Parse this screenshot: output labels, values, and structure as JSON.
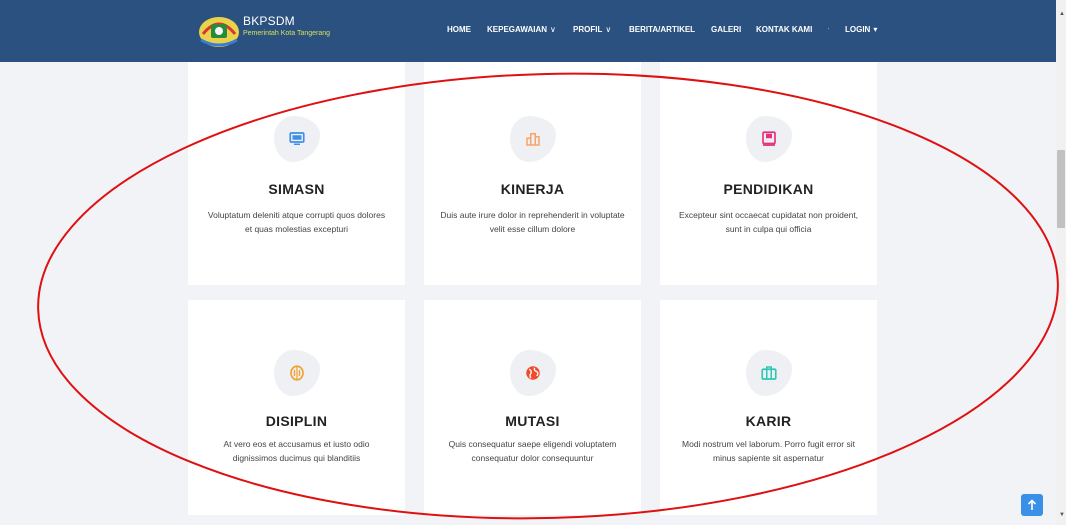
{
  "brand": {
    "name": "BKPSDM",
    "subtitle": "Pemerintah Kota Tangerang"
  },
  "nav": [
    {
      "label": "HOME",
      "caret": ""
    },
    {
      "label": "KEPEGAWAIAN",
      "caret": "∨"
    },
    {
      "label": "PROFIL",
      "caret": "∨"
    },
    {
      "label": "BERITA/ARTIKEL",
      "caret": ""
    },
    {
      "label": "GALERI",
      "caret": ""
    },
    {
      "label": "KONTAK KAMI",
      "caret": ""
    },
    {
      "label": "LOGIN",
      "caret": "▾"
    }
  ],
  "cards": [
    {
      "title": "SIMASN",
      "icon": "monitor-icon",
      "color": "#3d8fe8",
      "desc1": "Voluptatum deleniti atque corrupti quos dolores",
      "desc2": "et quas molestias excepturi"
    },
    {
      "title": "KINERJA",
      "icon": "bar-chart-icon",
      "color": "#f7a46b",
      "desc1": "Duis aute irure dolor in reprehenderit in voluptate",
      "desc2": "velit esse cillum dolore"
    },
    {
      "title": "PENDIDIKAN",
      "icon": "book-icon",
      "color": "#e5307c",
      "desc1": "Excepteur sint occaecat cupidatat non proident,",
      "desc2": "sunt in culpa qui officia"
    },
    {
      "title": "DISIPLIN",
      "icon": "brain-icon",
      "color": "#f0a030",
      "desc1": "At vero eos et accusamus et iusto odio",
      "desc2": "dignissimos ducimus qui blanditiis"
    },
    {
      "title": "MUTASI",
      "icon": "globe-icon",
      "color": "#f04b2c",
      "desc1": "Quis consequatur saepe eligendi voluptatem",
      "desc2": "consequatur dolor consequuntur"
    },
    {
      "title": "KARIR",
      "icon": "briefcase-icon",
      "color": "#2fc7b5",
      "desc1": "Modi nostrum vel laborum. Porro fugit error sit",
      "desc2": "minus sapiente sit aspernatur"
    }
  ],
  "colors": {
    "header": "#2b5180",
    "annotation": "#e01010",
    "back_to_top": "#3a8fe6"
  }
}
